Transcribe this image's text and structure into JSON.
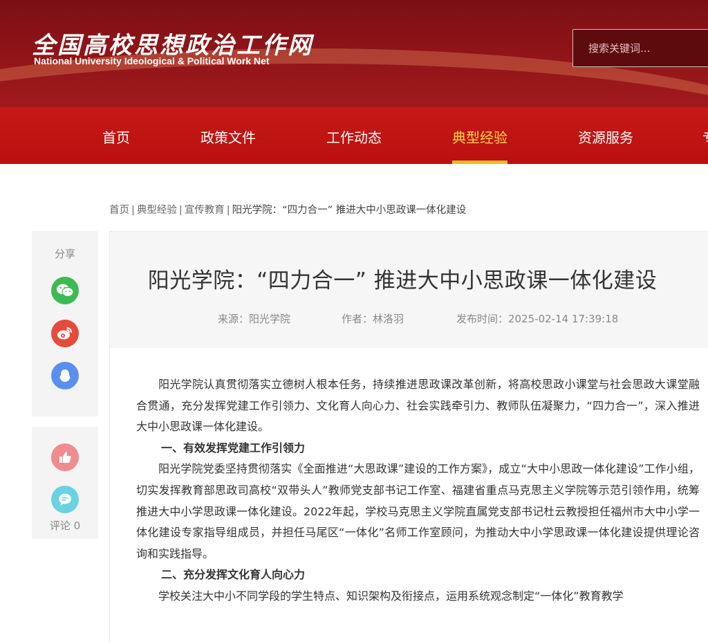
{
  "header": {
    "logo_cn": "全国高校思想政治工作网",
    "logo_en": "National University Ideological & Political Work Net",
    "search_placeholder": "搜索关键词..."
  },
  "nav": {
    "items": [
      "首页",
      "政策文件",
      "工作动态",
      "典型经验",
      "资源服务",
      "专"
    ],
    "active": "典型经验"
  },
  "breadcrumb": {
    "items": [
      "首页",
      "典型经验",
      "宣传教育"
    ],
    "current": "阳光学院：“四力合一” 推进大中小思政课一体化建设",
    "separator": "|"
  },
  "share": {
    "label": "分享",
    "buttons": [
      "wechat-icon",
      "weibo-icon",
      "qq-icon"
    ],
    "colors": {
      "wechat": "#3dbb53",
      "weibo": "#e64a3b",
      "qq": "#5a8ff0"
    }
  },
  "actions": {
    "comment_label": "评论 0"
  },
  "article": {
    "title": "阳光学院：“四力合一” 推进大中小思政课一体化建设",
    "source": "来源：阳光学院",
    "author": "作者：林洛羽",
    "published": "发布时间：2025-02-14 17:39:18",
    "intro": "阳光学院认真贯彻落实立德树人根本任务，持续推进思政课改革创新，将高校思政小课堂与社会思政大课堂融合贯通，充分发挥党建工作引领力、文化育人向心力、社会实践牵引力、教师队伍凝聚力，“四力合一”，深入推进大中小思政课一体化建设。",
    "heading1": "一、有效发挥党建工作引领力",
    "para1": "阳光学院党委坚持贯彻落实《全面推进“大思政课”建设的工作方案》，成立“大中小思政一体化建设”工作小组，切实发挥教育部思政司高校“双带头人”教师党支部书记工作室、福建省重点马克思主义学院等示范引领作用，统筹推进大中小学思政课一体化建设。2022年起，学校马克思主义学院直属党支部书记杜云教授担任福州市大中小学一体化建设专家指导组成员，并担任马尾区“一体化”名师工作室顾问，为推动大中小学思政课一体化建设提供理论咨询和实践指导。",
    "heading2": "二、充分发挥文化育人向心力",
    "para2": "学校关注大中小不同学段的学生特点、知识架构及衔接点，运用系统观念制定“一体化”教育教学"
  },
  "colors": {
    "header_bg": "#8e1418",
    "nav_bg": "#c51a17",
    "nav_active": "#ffd24a",
    "nav_underline": "#f4b82e"
  }
}
